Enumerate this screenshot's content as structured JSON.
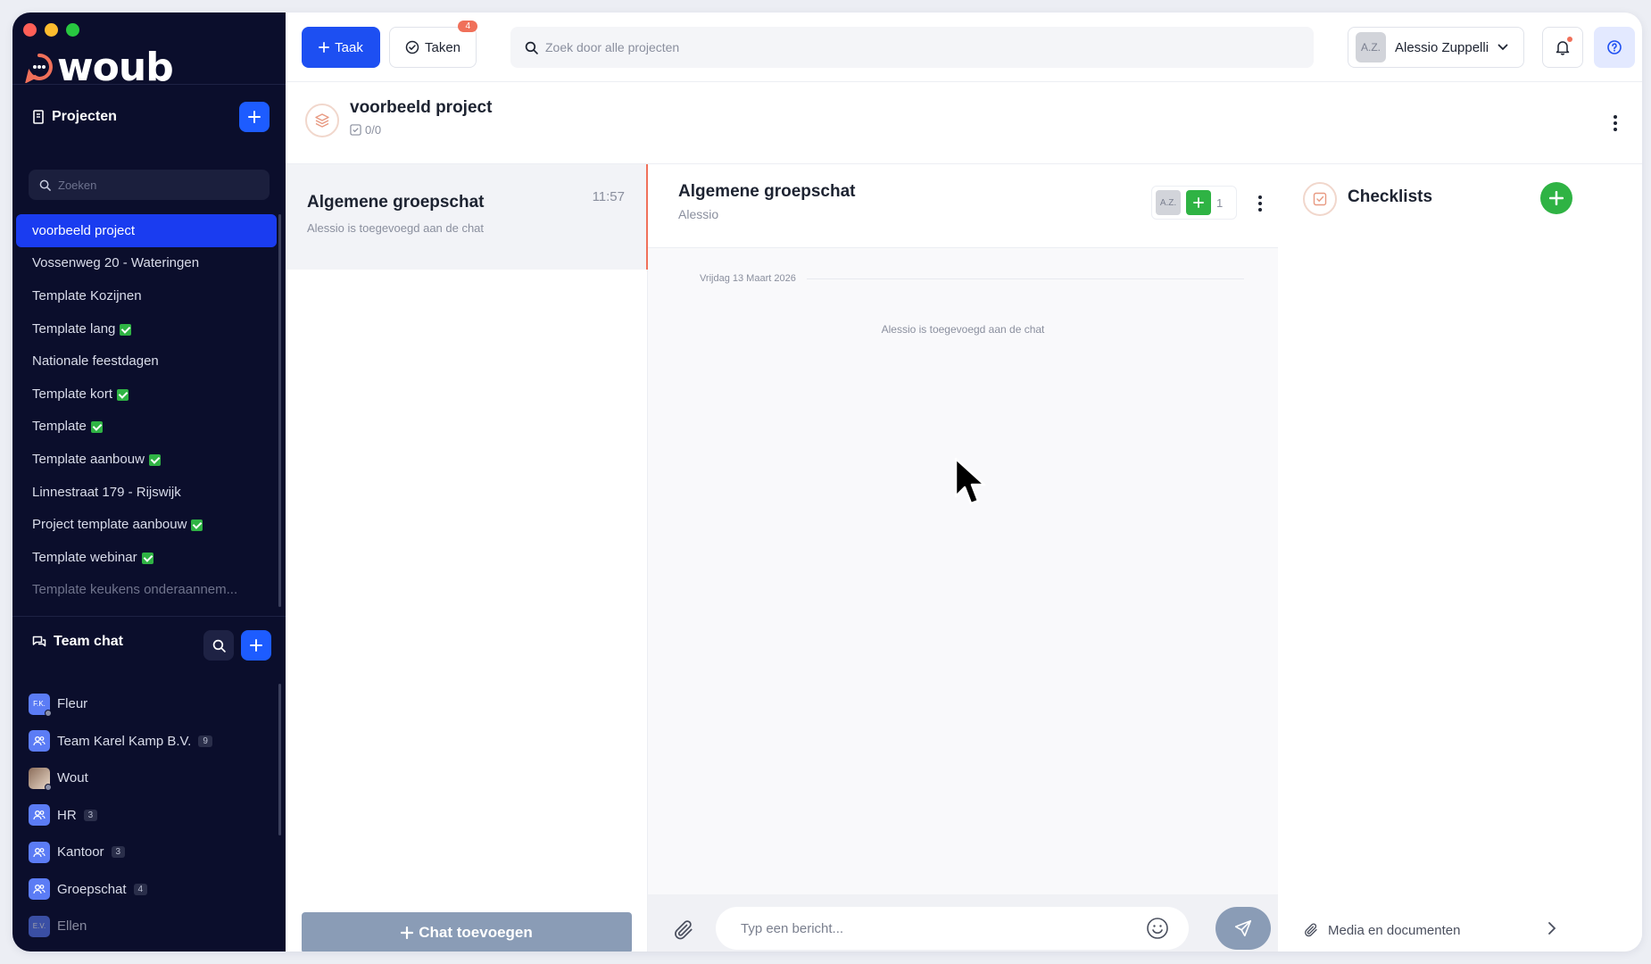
{
  "window": {
    "traffic_colors": [
      "#ff5f57",
      "#febc2e",
      "#28c840"
    ]
  },
  "brand": {
    "name": "woub",
    "accent": "#1d4ff2",
    "logo_ring": "#f0705a"
  },
  "sidebar": {
    "projects_title": "Projecten",
    "search_placeholder": "Zoeken",
    "projects": [
      {
        "label": "voorbeeld project",
        "active": true,
        "check": false
      },
      {
        "label": "Vossenweg 20 - Wateringen",
        "check": false
      },
      {
        "label": "Template Kozijnen",
        "check": false
      },
      {
        "label": "Template lang",
        "check": true
      },
      {
        "label": "Nationale feestdagen",
        "check": false
      },
      {
        "label": "Template kort",
        "check": true
      },
      {
        "label": "Template",
        "check": true
      },
      {
        "label": "Template aanbouw",
        "check": true
      },
      {
        "label": "Linnestraat 179 - Rijswijk",
        "check": false
      },
      {
        "label": "Project template aanbouw",
        "check": true
      },
      {
        "label": "Template webinar",
        "check": true
      },
      {
        "label": "Template keukens onderaannem...",
        "check": false,
        "faded": true
      }
    ],
    "team_chat_title": "Team chat",
    "chats": [
      {
        "label": "Fleur",
        "initials": "F.K.",
        "count": "",
        "type": "user"
      },
      {
        "label": "Team Karel Kamp B.V.",
        "count": "9",
        "type": "group"
      },
      {
        "label": "Wout",
        "count": "",
        "type": "photo"
      },
      {
        "label": "HR",
        "count": "3",
        "type": "group"
      },
      {
        "label": "Kantoor",
        "count": "3",
        "type": "group"
      },
      {
        "label": "Groepschat",
        "count": "4",
        "type": "group"
      },
      {
        "label": "Ellen",
        "initials": "E.V.",
        "count": "",
        "type": "user"
      }
    ]
  },
  "topbar": {
    "new_task_label": "Taak",
    "tasks_label": "Taken",
    "tasks_badge": "4",
    "search_placeholder": "Zoek door alle projecten",
    "user_initials": "A.Z.",
    "user_name": "Alessio Zuppelli"
  },
  "project": {
    "title": "voorbeeld project",
    "progress": "0/0"
  },
  "conversations": [
    {
      "title": "Algemene groepschat",
      "preview": "Alessio is toegevoegd aan de chat",
      "time": "11:57"
    }
  ],
  "add_chat_label": "Chat toevoegen",
  "chat": {
    "title": "Algemene groepschat",
    "subtitle": "Alessio",
    "member_initials": "A.Z.",
    "member_count": "1",
    "date_separator": "Vrijdag 13 Maart 2026",
    "system_message": "Alessio is toegevoegd aan de chat",
    "input_placeholder": "Typ een bericht..."
  },
  "checklists": {
    "title": "Checklists",
    "media_label": "Media en documenten"
  }
}
